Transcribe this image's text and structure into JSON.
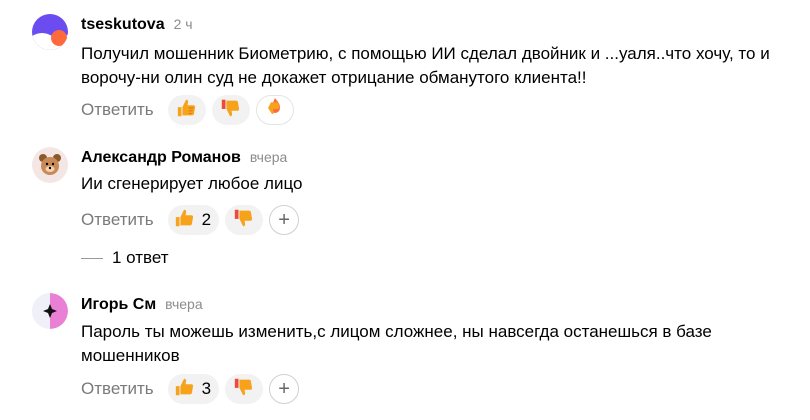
{
  "comments": [
    {
      "author": "tseskutova",
      "time": "2 ч",
      "text": "Получил мошенник Биометрию, с помощью ИИ сделал двойник и ...уаля..что хочу, то и ворочу-ни олин суд не докажет отрицание обманутого клиента!!",
      "reply_label": "Ответить",
      "reactions": {
        "like_count": "",
        "dislike_count": "",
        "extra_icon": "thumbs-down-fire-icon"
      },
      "avatar_colors": [
        "#6b4cf0",
        "#ff6a3d"
      ]
    },
    {
      "author": "Александр Романов",
      "time": "вчера",
      "text": "Ии сгенерирует любое лицо",
      "reply_label": "Ответить",
      "reactions": {
        "like_count": "2",
        "dislike_count": ""
      },
      "avatar_colors": [
        "#f5e6e6",
        "#c98a57"
      ],
      "replies_label": "1 ответ"
    },
    {
      "author": "Игорь См",
      "time": "вчера",
      "text": "Пароль ты можешь изменить,с лицом сложнее, ны навсегда останешься в базе мошенников",
      "reply_label": "Ответить",
      "reactions": {
        "like_count": "3",
        "dislike_count": ""
      },
      "avatar_colors": [
        "#f3f0f5",
        "#e86bd0"
      ]
    }
  ],
  "icons": {
    "like": "thumbs-up-icon",
    "dislike": "thumbs-down-icon",
    "add_reaction": "plus-icon"
  }
}
